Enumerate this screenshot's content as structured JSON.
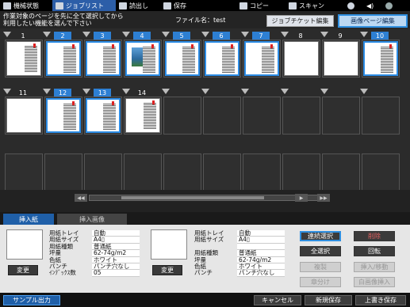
{
  "nav": {
    "tabs": [
      {
        "label": "機械状態",
        "icon": "machine-status-icon"
      },
      {
        "label": "ジョブリスト",
        "icon": "job-list-icon"
      },
      {
        "label": "読出し",
        "icon": "read-icon"
      },
      {
        "label": "保存",
        "icon": "save-icon"
      },
      {
        "label": "コピー",
        "icon": "copy-icon"
      },
      {
        "label": "スキャン",
        "icon": "scan-icon"
      }
    ]
  },
  "header": {
    "instruction_line1": "作業対象のページを先に全て選択してから",
    "instruction_line2": "利用したい機能を選んで下さい",
    "filename": "ファイル名：test",
    "job_ticket_edit": "ジョブチケット編集",
    "page_edit": "画像ページ編集"
  },
  "pages_row1": [
    "1",
    "2",
    "3",
    "4",
    "5",
    "6",
    "7",
    "8",
    "9",
    "10"
  ],
  "pages_row2": [
    "11",
    "12",
    "13",
    "14"
  ],
  "tabs": {
    "insert_paper": "挿入紙",
    "insert_image": "挿入画像"
  },
  "left_props": [
    {
      "k": "用紙トレイ",
      "v": "自動"
    },
    {
      "k": "用紙サイズ",
      "v": "A4▯"
    },
    {
      "k": "用紙種類",
      "v": "普通紙"
    },
    {
      "k": "坪量",
      "v": "62-74g/m2"
    },
    {
      "k": "色紙",
      "v": "ホワイト"
    },
    {
      "k": "パンチ",
      "v": "パンチ穴なし"
    },
    {
      "k": "ｲﾝﾃﾞｯｸｽ数",
      "v": "05"
    }
  ],
  "right_props": [
    {
      "k": "用紙トレイ",
      "v": "自動"
    },
    {
      "k": "用紙サイズ",
      "v": "A4▯"
    },
    {
      "k": "",
      "v": ""
    },
    {
      "k": "用紙種類",
      "v": "普通紙"
    },
    {
      "k": "坪量",
      "v": "62-74g/m2"
    },
    {
      "k": "色紙",
      "v": "ホワイト"
    },
    {
      "k": "パンチ",
      "v": "パンチ穴なし"
    }
  ],
  "change_label": "変更",
  "actions": {
    "continuous_select": "連続選択",
    "delete": "削除",
    "select_all": "全選択",
    "rotate": "回転",
    "duplicate": "複製",
    "insert_move": "挿入/移動",
    "chapter": "章分け",
    "blank_insert": "白画像挿入"
  },
  "bottom": {
    "sample": "サンプル出力",
    "cancel": "キャンセル",
    "save_new": "新規保存",
    "overwrite": "上書き保存"
  }
}
